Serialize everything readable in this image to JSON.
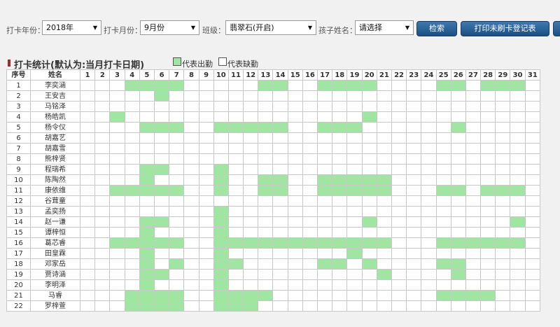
{
  "filters": {
    "year_label": "打卡年份：",
    "year_value": "2018年",
    "month_label": "打卡月份：",
    "month_value": "9月份",
    "class_label": "班级：",
    "class_value": "翡翠石(开启)",
    "child_label": "孩子姓名：",
    "child_value": "请选择"
  },
  "buttons": {
    "search": "检索",
    "print": "打印未刷卡登记表"
  },
  "stats": {
    "title": "打卡统计(默认为:当月打卡日期)",
    "legend_present": "代表出勤",
    "legend_absent": "代表缺勤"
  },
  "colors": {
    "present": "#a0e6a2",
    "button": "#2a5f94",
    "title_marker": "#a52a2a"
  },
  "table": {
    "headers": [
      "序号",
      "姓名",
      "1",
      "2",
      "3",
      "4",
      "5",
      "6",
      "7",
      "8",
      "9",
      "10",
      "11",
      "12",
      "13",
      "14",
      "15",
      "16",
      "17",
      "18",
      "19",
      "20",
      "21",
      "22",
      "23",
      "24",
      "25",
      "26",
      "27",
      "28",
      "29",
      "30",
      "31"
    ],
    "rows": [
      {
        "no": "1",
        "name": "李奕涵",
        "present": [
          4,
          5,
          6,
          7,
          13,
          14,
          17,
          18,
          19,
          20,
          25,
          26,
          28,
          29,
          30
        ]
      },
      {
        "no": "2",
        "name": "王安吉",
        "present": [
          6
        ]
      },
      {
        "no": "3",
        "name": "马铭泽",
        "present": []
      },
      {
        "no": "4",
        "name": "杨皓凯",
        "present": [
          3,
          20
        ]
      },
      {
        "no": "5",
        "name": "杨令仪",
        "present": [
          5,
          6,
          7,
          10,
          11,
          12,
          13,
          14,
          17,
          18,
          19,
          26
        ]
      },
      {
        "no": "6",
        "name": "胡嘉艺",
        "present": []
      },
      {
        "no": "7",
        "name": "胡嘉雪",
        "present": []
      },
      {
        "no": "8",
        "name": "熊梓贤",
        "present": []
      },
      {
        "no": "9",
        "name": "程瑞希",
        "present": [
          5,
          6,
          10
        ]
      },
      {
        "no": "10",
        "name": "陈陶然",
        "present": [
          5,
          10,
          13,
          14,
          17,
          18,
          19,
          20,
          21
        ]
      },
      {
        "no": "11",
        "name": "康依维",
        "present": [
          3,
          4,
          5,
          6,
          7,
          10,
          13,
          14,
          17,
          18,
          19,
          20,
          21,
          25,
          26,
          28,
          29,
          30
        ]
      },
      {
        "no": "12",
        "name": "谷茸童",
        "present": []
      },
      {
        "no": "13",
        "name": "孟奕扬",
        "present": [
          10
        ]
      },
      {
        "no": "14",
        "name": "赵一谦",
        "present": [
          5,
          6,
          10,
          20,
          30
        ]
      },
      {
        "no": "15",
        "name": "谭梓恒",
        "present": [
          5,
          10
        ]
      },
      {
        "no": "16",
        "name": "葛芯睿",
        "present": [
          3,
          4,
          5,
          6,
          7,
          10,
          11,
          12,
          13,
          14,
          15,
          16,
          17,
          18,
          19,
          20,
          21,
          25,
          26,
          27,
          28,
          29,
          30
        ]
      },
      {
        "no": "17",
        "name": "田皇霖",
        "present": [
          5,
          10,
          19
        ]
      },
      {
        "no": "18",
        "name": "邓家岳",
        "present": [
          5,
          7,
          10,
          11,
          17,
          18,
          20,
          25,
          26
        ]
      },
      {
        "no": "19",
        "name": "贾诗涵",
        "present": [
          5,
          6,
          10,
          21,
          26
        ]
      },
      {
        "no": "20",
        "name": "李明泽",
        "present": [
          5,
          10
        ]
      },
      {
        "no": "21",
        "name": "马睿",
        "present": [
          4,
          5,
          6,
          7,
          10,
          11,
          12,
          13,
          25,
          26,
          27,
          28
        ]
      },
      {
        "no": "22",
        "name": "罗梓萱",
        "present": [
          4,
          5,
          6,
          7,
          10,
          11,
          12
        ]
      }
    ]
  }
}
